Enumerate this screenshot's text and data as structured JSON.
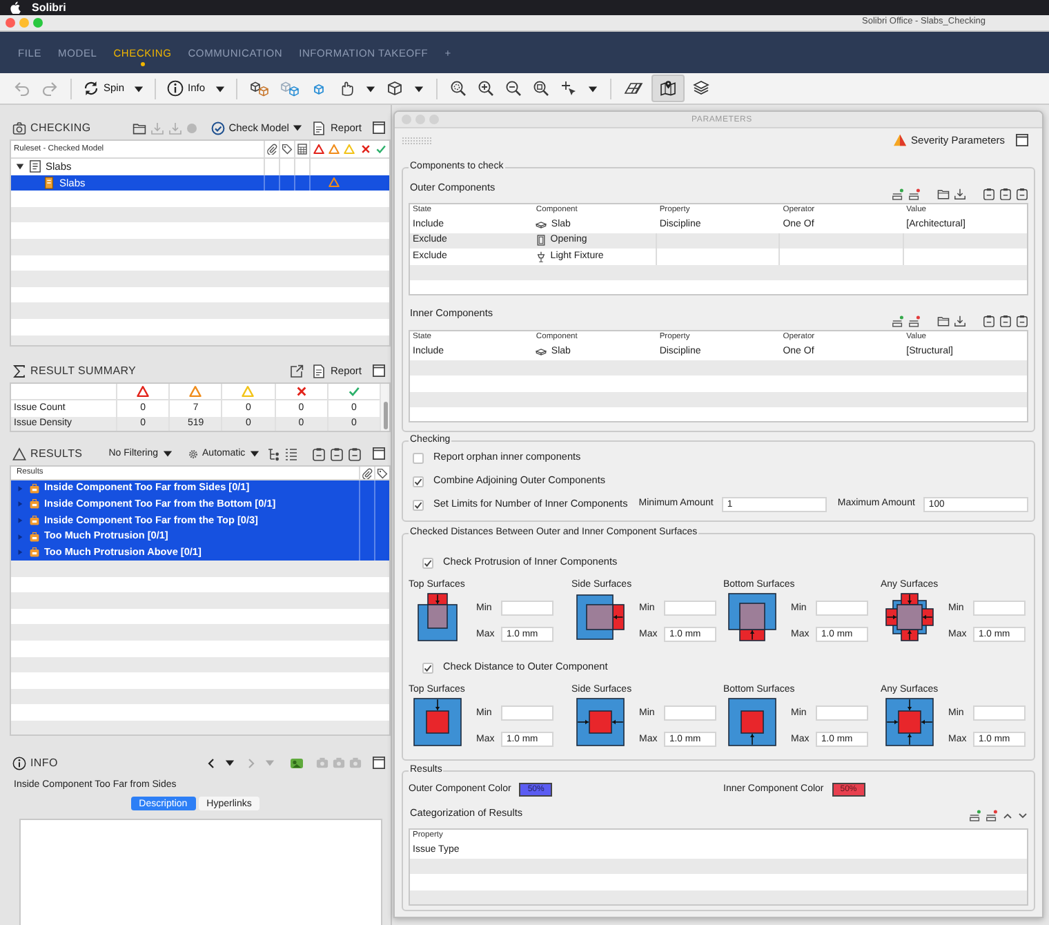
{
  "menubar": {
    "app_name": "Solibri"
  },
  "window": {
    "title": "Solibri Office - Slabs_Checking"
  },
  "nav_tabs": [
    {
      "label": "FILE",
      "selected": false
    },
    {
      "label": "MODEL",
      "selected": false
    },
    {
      "label": "CHECKING",
      "selected": true
    },
    {
      "label": "COMMUNICATION",
      "selected": false
    },
    {
      "label": "INFORMATION TAKEOFF",
      "selected": false
    },
    {
      "label": "+",
      "selected": false
    }
  ],
  "toolbar": {
    "spin_label": "Spin",
    "info_label": "Info",
    "map_view_on": true
  },
  "checking_panel": {
    "title": "CHECKING",
    "check_button": "Check Model",
    "report_button": "Report",
    "column_header": "Ruleset - Checked Model",
    "tree": [
      {
        "label": "Slabs",
        "expanded": true,
        "selected": false,
        "children": [
          {
            "label": "Slabs",
            "selected": true,
            "moderate_issue": true
          }
        ]
      }
    ]
  },
  "result_summary": {
    "title": "RESULT SUMMARY",
    "report_button": "Report",
    "rows": [
      {
        "label": "Issue Count",
        "values": [
          "0",
          "7",
          "0",
          "0",
          "0"
        ]
      },
      {
        "label": "Issue Density",
        "values": [
          "0",
          "519",
          "0",
          "0",
          "0"
        ]
      }
    ]
  },
  "results_panel": {
    "title": "RESULTS",
    "filter": "No Filtering",
    "mode": "Automatic",
    "column_header": "Results",
    "rows": [
      {
        "label": "Inside Component Too Far from Sides [0/1]",
        "selected": true
      },
      {
        "label": "Inside Component Too Far from the Bottom [0/1]",
        "selected": true
      },
      {
        "label": "Inside Component Too Far from the Top [0/3]",
        "selected": true
      },
      {
        "label": "Too Much Protrusion [0/1]",
        "selected": true
      },
      {
        "label": "Too Much Protrusion Above [0/1]",
        "selected": true
      }
    ]
  },
  "info_panel": {
    "title": "INFO",
    "heading": "Inside Component Too Far from Sides",
    "tabs": [
      {
        "label": "Description",
        "selected": true
      },
      {
        "label": "Hyperlinks",
        "selected": false
      }
    ]
  },
  "parameters": {
    "title": "PARAMETERS",
    "severity_button": "Severity Parameters",
    "components_group": {
      "title": "Components to check",
      "tables": [
        {
          "title": "Outer Components",
          "columns": [
            "State",
            "Component",
            "Property",
            "Operator",
            "Value"
          ],
          "rows": [
            {
              "state": "Include",
              "component": "Slab",
              "kind": "slab",
              "property": "Discipline",
              "operator": "One Of",
              "value": "[Architectural]"
            },
            {
              "state": "Exclude",
              "component": "Opening",
              "kind": "opening"
            },
            {
              "state": "Exclude",
              "component": "Light Fixture",
              "kind": "light_fixture"
            }
          ]
        },
        {
          "title": "Inner Components",
          "columns": [
            "State",
            "Component",
            "Property",
            "Operator",
            "Value"
          ],
          "rows": [
            {
              "state": "Include",
              "component": "Slab",
              "kind": "slab",
              "property": "Discipline",
              "operator": "One Of",
              "value": "[Structural]"
            }
          ]
        }
      ]
    },
    "checking_group": {
      "title": "Checking",
      "options": [
        {
          "label": "Report orphan inner components",
          "checked": false
        },
        {
          "label": "Combine Adjoining Outer Components",
          "checked": true
        },
        {
          "label": "Set Limits for Number of Inner Components",
          "checked": true,
          "fields": [
            {
              "label": "Minimum Amount",
              "value": "1"
            },
            {
              "label": "Maximum Amount",
              "value": "100"
            }
          ]
        }
      ]
    },
    "distances_group": {
      "title": "Checked Distances Between Outer and Inner Component Surfaces",
      "sections": [
        {
          "kind": "protrusion",
          "label": "Check Protrusion of Inner Components",
          "checked": true,
          "surfaces": [
            {
              "kind": "top",
              "label": "Top Surfaces",
              "min_label": "Min",
              "max_label": "Max",
              "max": "1.0 mm"
            },
            {
              "kind": "side",
              "label": "Side Surfaces",
              "min_label": "Min",
              "max_label": "Max",
              "max": "1.0 mm"
            },
            {
              "kind": "bottom",
              "label": "Bottom Surfaces",
              "min_label": "Min",
              "max_label": "Max",
              "max": "1.0 mm"
            },
            {
              "kind": "any",
              "label": "Any Surfaces",
              "min_label": "Min",
              "max_label": "Max",
              "max": "1.0 mm"
            }
          ]
        },
        {
          "kind": "distance",
          "label": "Check Distance to Outer Component",
          "checked": true,
          "surfaces": [
            {
              "kind": "top",
              "label": "Top Surfaces",
              "min_label": "Min",
              "max_label": "Max",
              "max": "1.0 mm"
            },
            {
              "kind": "side",
              "label": "Side Surfaces",
              "min_label": "Min",
              "max_label": "Max",
              "max": "1.0 mm"
            },
            {
              "kind": "bottom",
              "label": "Bottom Surfaces",
              "min_label": "Min",
              "max_label": "Max",
              "max": "1.0 mm"
            },
            {
              "kind": "any",
              "label": "Any Surfaces",
              "min_label": "Min",
              "max_label": "Max",
              "max": "1.0 mm"
            }
          ]
        }
      ]
    },
    "results_group": {
      "title": "Results",
      "colors": [
        {
          "label": "Outer Component Color",
          "swatch_text": "50%",
          "color": "#5b5cf2"
        },
        {
          "label": "Inner Component Color",
          "swatch_text": "50%",
          "color": "#e8404f"
        }
      ],
      "categorization": {
        "title": "Categorization of Results",
        "column": "Property",
        "rows": [
          "Issue Type"
        ]
      }
    }
  }
}
